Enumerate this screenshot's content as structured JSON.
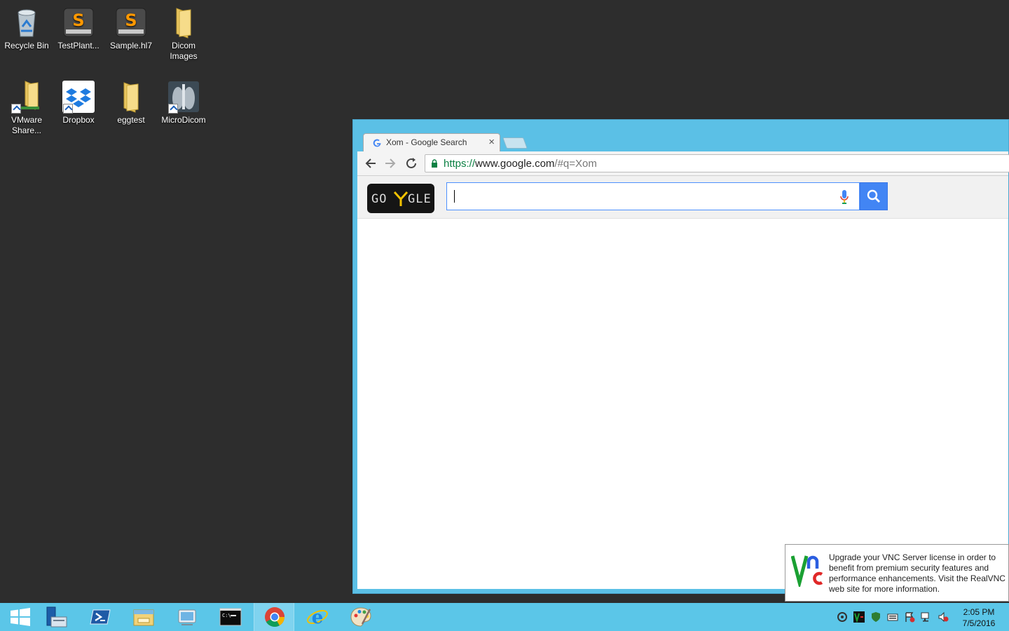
{
  "desktop": {
    "icons": [
      {
        "label": "Recycle Bin"
      },
      {
        "label": "TestPlant..."
      },
      {
        "label": "Sample.hl7"
      },
      {
        "label": "Dicom Images"
      },
      {
        "label": "VMware Share..."
      },
      {
        "label": "Dropbox"
      },
      {
        "label": "eggtest"
      },
      {
        "label": "MicroDicom"
      }
    ]
  },
  "browser": {
    "tab_title": "Xom - Google Search",
    "tab_close": "×",
    "url_scheme": "https://",
    "url_host": "www.google.com",
    "url_rest": "/#q=Xom",
    "doodle_left": "GO",
    "doodle_right": "GLE",
    "search_value": ""
  },
  "vnc_notice": {
    "message": "Upgrade your VNC Server license in order to benefit from premium security features and performance enhancements. Visit the RealVNC web site for more information."
  },
  "taskbar": {
    "items": [
      "start-button",
      "server-manager",
      "powershell",
      "file-explorer",
      "remote-desktop",
      "command-prompt",
      "chrome",
      "internet-explorer",
      "paint"
    ],
    "active_item": "chrome",
    "clock_time": "2:05 PM",
    "clock_date": "7/5/2016"
  },
  "colors": {
    "desktop_bg": "#2d2d2d",
    "taskbar_bg": "#5bc6e8",
    "window_frame": "#5bc0e6",
    "google_blue": "#4285f4"
  }
}
